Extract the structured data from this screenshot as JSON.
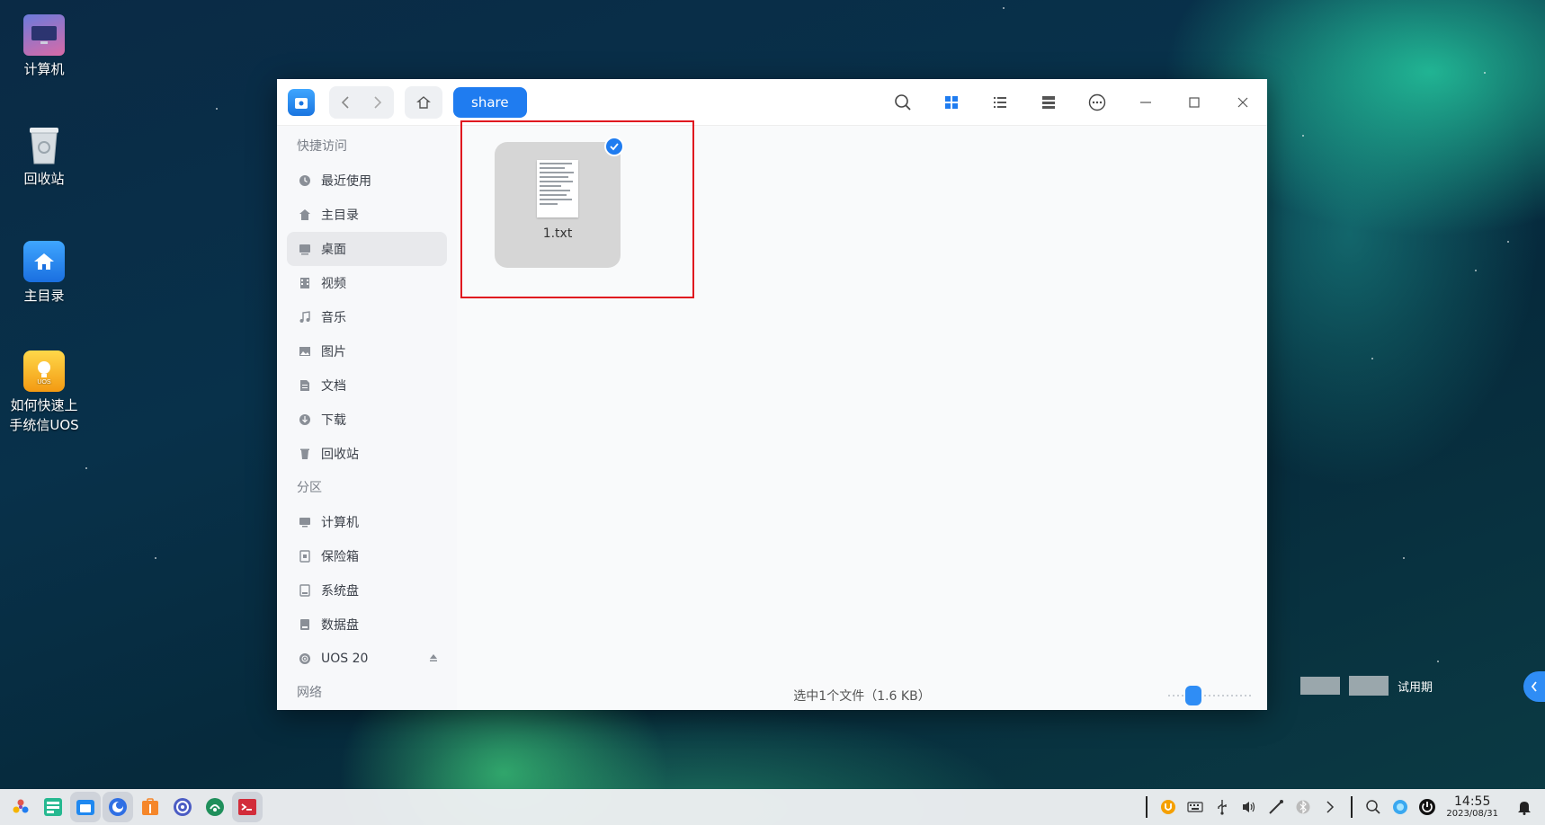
{
  "desktop": {
    "icons": [
      {
        "label": "计算机"
      },
      {
        "label": "回收站"
      },
      {
        "label": "主目录"
      },
      {
        "label": "如何快速上手统信UOS"
      }
    ]
  },
  "window": {
    "breadcrumb": "share",
    "sidebar": {
      "quick_access_header": "快捷访问",
      "items": [
        {
          "label": "最近使用"
        },
        {
          "label": "主目录"
        },
        {
          "label": "桌面"
        },
        {
          "label": "视频"
        },
        {
          "label": "音乐"
        },
        {
          "label": "图片"
        },
        {
          "label": "文档"
        },
        {
          "label": "下载"
        },
        {
          "label": "回收站"
        }
      ],
      "partition_header": "分区",
      "partitions": [
        {
          "label": "计算机"
        },
        {
          "label": "保险箱"
        },
        {
          "label": "系统盘"
        },
        {
          "label": "数据盘"
        },
        {
          "label": "UOS 20"
        }
      ],
      "network_header": "网络"
    },
    "files": [
      {
        "name": "1.txt",
        "selected": true
      }
    ],
    "status_text": "选中1个文件（1.6 KB）",
    "zoom_level_fraction": 0.25,
    "accent_color": "#1f7cf0"
  },
  "trial_label": "试用期",
  "taskbar": {
    "time": "14:55",
    "date": "2023/08/31"
  }
}
